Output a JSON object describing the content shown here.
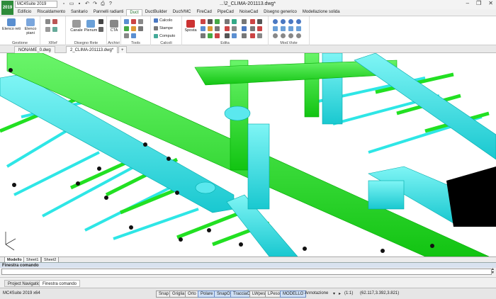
{
  "app": {
    "logo": "2019",
    "product": "MC4Suite 2019",
    "window_title": "...\\2_CLIMA-201113.dwg*"
  },
  "ribbon_tabs": [
    "Edificio",
    "Riscaldamento",
    "Sanitario",
    "Pannelli radianti",
    "Duct",
    "DuctBuilder",
    "DuctVMC",
    "FireCad",
    "PipeCad",
    "NoiseCad",
    "Disegno generico",
    "Modellazione solida"
  ],
  "ribbon": {
    "gestione": {
      "label": "Gestione",
      "btn1": "Elenco reti",
      "btn2": "Elenco piani"
    },
    "xref": {
      "label": "XRef"
    },
    "disegno": {
      "label": "Disegno Rete",
      "canale": "Canale",
      "plenum": "Plenum"
    },
    "archivi": {
      "label": "Archivi",
      "cta": "CTA"
    },
    "tools": {
      "label": "Tools"
    },
    "calcoli": {
      "label": "Calcoli",
      "calcolo": "Calcolo",
      "stampe": "Stampe",
      "computo": "Computo"
    },
    "edita": {
      "label": "Edita",
      "sposta": "Sposta"
    },
    "mod_viste": {
      "label": "Mod.Viste"
    }
  },
  "doc_tabs": [
    "NONAME_0.dwg",
    "2_CLIMA-201113.dwg*",
    "+"
  ],
  "sheet_tabs": [
    "Modello",
    "Sheet1",
    "Sheet2"
  ],
  "command": {
    "title": "Finestra comando"
  },
  "bottom_tabs": [
    "Project Navigation",
    "Finestra comando"
  ],
  "status": {
    "app_label": "MC4Suite 2019 x64",
    "toggles": [
      "Snap",
      "Griglia",
      "Orto",
      "Polare",
      "SnapO",
      "TracciaO",
      "LWpeso",
      "LPeso",
      "MODELLO"
    ],
    "on": [
      "Polare",
      "SnapO",
      "TracciaO",
      "MODELLO"
    ],
    "annotation": "Annotazione",
    "scale": "(1:1)",
    "coords": "(62.117,3.392,3.821)"
  },
  "colors": {
    "green": "#22e022",
    "cyan": "#2ee6e6",
    "accent": "#1e6f2a"
  }
}
